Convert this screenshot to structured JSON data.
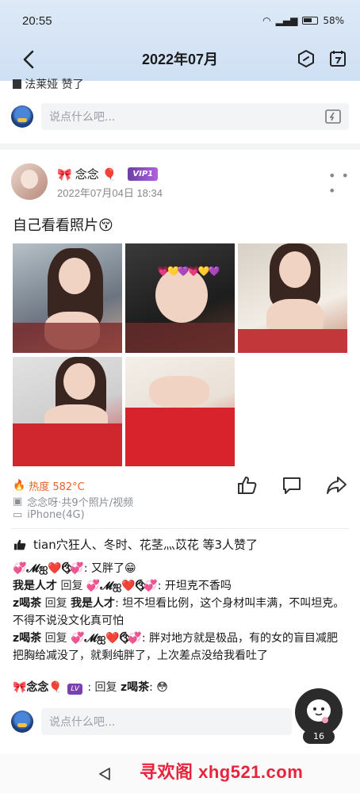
{
  "status": {
    "time": "20:55",
    "battery": "58%"
  },
  "header": {
    "title": "2022年07月"
  },
  "prev_post": {
    "tail_text": "法莱娅 赞了"
  },
  "comment_placeholder": "说点什么吧...",
  "post": {
    "nickname": "念念",
    "vip_label": "VIP1",
    "time": "2022年07月04日 18:34",
    "text": "自己看看照片😚",
    "heat": "热度 582°C",
    "album": "念念呀·共9个照片/视频",
    "device": "iPhone(4G)",
    "likes_text": "tian穴狂人、冬时、花茎灬苡花 等3人赞了"
  },
  "comments": [
    {
      "author": "💞𝓜ஐ❤️ઉ⃟💞",
      "reply_word": "",
      "target": "",
      "text": ": 又胖了😁"
    },
    {
      "author": "我是人才",
      "reply_word": "回复",
      "target": "💞𝓜ஐ❤️ઉ⃟💞",
      "text": ": 开坦克不香吗"
    },
    {
      "author": "z喝茶",
      "reply_word": "回复",
      "target": "我是人才",
      "text": ": 坦不坦看比例，这个身材叫丰满，不叫坦克。不得不说没文化真可怕"
    },
    {
      "author": "z喝茶",
      "reply_word": "回复",
      "target": "💞𝓜ஐ❤️ઉ⃟💞",
      "text": ": 胖对地方就是极品，有的女的盲目减肥把胸给减没了，就剩纯胖了，上次差点没给我看吐了"
    },
    {
      "author": "🎀念念🎈",
      "reply_word": ": 回复",
      "target": "z喝茶",
      "text": ": 😳"
    }
  ],
  "fab_badge": "16",
  "watermark": "寻欢阁 xhg521.com"
}
